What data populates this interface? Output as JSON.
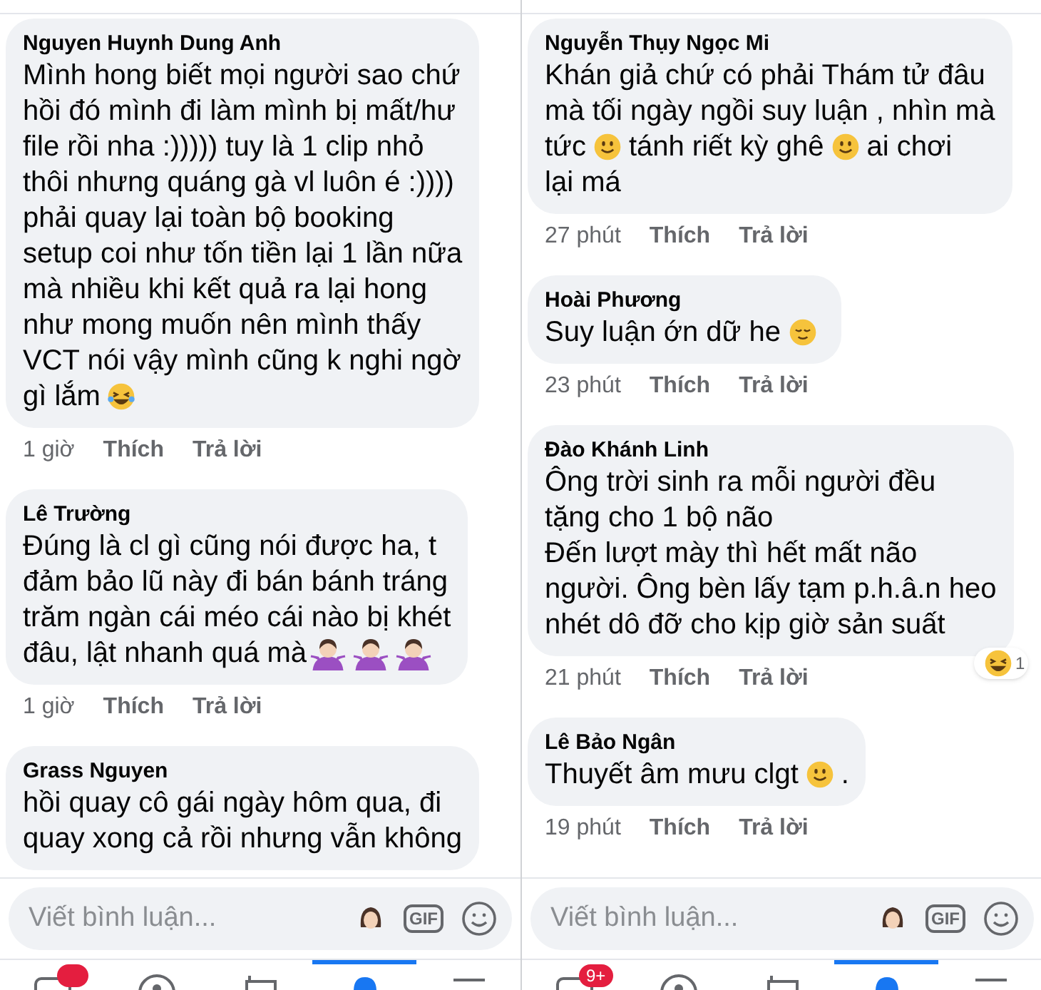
{
  "panels": [
    {
      "comments": [
        {
          "author": "Nguyen Huynh Dung Anh",
          "lines": [
            [
              {
                "kind": "text",
                "text": "Mình hong biết mọi người sao chứ"
              }
            ],
            [
              {
                "kind": "text",
                "text": "hồi đó mình đi làm mình bị mất/hư"
              }
            ],
            [
              {
                "kind": "text",
                "text": "file rồi nha :))))) tuy là 1 clip nhỏ"
              }
            ],
            [
              {
                "kind": "text",
                "text": "thôi nhưng quáng gà vl luôn é :))))"
              }
            ],
            [
              {
                "kind": "text",
                "text": "phải quay lại toàn bộ booking"
              }
            ],
            [
              {
                "kind": "text",
                "text": "setup coi như tốn tiền lại 1 lần nữa"
              }
            ],
            [
              {
                "kind": "text",
                "text": "mà nhiều khi kết quả ra lại hong"
              }
            ],
            [
              {
                "kind": "text",
                "text": "như mong muốn nên mình thấy"
              }
            ],
            [
              {
                "kind": "text",
                "text": "VCT nói vậy mình cũng k nghi ngờ"
              }
            ],
            [
              {
                "kind": "text",
                "text": "gì lắm"
              },
              {
                "kind": "tears"
              }
            ]
          ],
          "time": "1 giờ",
          "like": "Thích",
          "reply": "Trả lời"
        },
        {
          "author": "Lê Trường",
          "lines": [
            [
              {
                "kind": "text",
                "text": "Đúng là cl gì cũng nói được ha, t"
              }
            ],
            [
              {
                "kind": "text",
                "text": "đảm bảo lũ này đi bán bánh tráng"
              }
            ],
            [
              {
                "kind": "text",
                "text": "trăm ngàn cái méo cái nào bị khét"
              }
            ],
            [
              {
                "kind": "text",
                "text": "đâu, lật nhanh quá mà"
              },
              {
                "kind": "shrug"
              },
              {
                "kind": "shrug"
              },
              {
                "kind": "shrug"
              }
            ]
          ],
          "time": "1 giờ",
          "like": "Thích",
          "reply": "Trả lời"
        },
        {
          "author": "Grass Nguyen",
          "lines": [
            [
              {
                "kind": "text",
                "text": "hồi quay cô gái ngày hôm qua, đi"
              }
            ],
            [
              {
                "kind": "text",
                "text": "quay xong cả rồi nhưng vẫn không"
              }
            ]
          ]
        }
      ],
      "composer": {
        "placeholder": "Viết bình luận...",
        "gif": "GIF"
      },
      "nav": [
        {
          "selected": false,
          "has_badge": true
        },
        {
          "selected": false
        },
        {
          "selected": false
        },
        {
          "selected": true
        },
        {
          "selected": false
        }
      ]
    },
    {
      "comments": [
        {
          "author": "Nguyễn Thụy Ngọc Mi",
          "lines": [
            [
              {
                "kind": "text",
                "text": "Khán giả chứ có phải Thám tử đâu"
              }
            ],
            [
              {
                "kind": "text",
                "text": "mà tối ngày ngồi suy luận , nhìn mà"
              }
            ],
            [
              {
                "kind": "text",
                "text": "tức"
              },
              {
                "kind": "smile"
              },
              {
                "kind": "text",
                "text": "tánh riết kỳ ghê"
              },
              {
                "kind": "smile"
              },
              {
                "kind": "text",
                "text": "ai chơi"
              }
            ],
            [
              {
                "kind": "text",
                "text": "lại má"
              }
            ]
          ],
          "time": "27 phút",
          "like": "Thích",
          "reply": "Trả lời"
        },
        {
          "author": "Hoài Phương",
          "lines": [
            [
              {
                "kind": "text",
                "text": "Suy luận ớn dữ he"
              },
              {
                "kind": "relieved"
              }
            ]
          ],
          "time": "23 phút",
          "like": "Thích",
          "reply": "Trả lời"
        },
        {
          "author": "Đào Khánh Linh",
          "lines": [
            [
              {
                "kind": "text",
                "text": "Ông trời sinh ra mỗi người đều"
              }
            ],
            [
              {
                "kind": "text",
                "text": "tặng cho 1 bộ não"
              }
            ],
            [
              {
                "kind": "text",
                "text": "Đến lượt mày thì hết mất não"
              }
            ],
            [
              {
                "kind": "text",
                "text": "người. Ông bèn lấy tạm p.h.â.n heo"
              }
            ],
            [
              {
                "kind": "text",
                "text": "nhét dô đỡ cho kịp giờ sản suất"
              }
            ]
          ],
          "time": "21 phút",
          "like": "Thích",
          "reply": "Trả lời",
          "reaction_count": "1"
        },
        {
          "author": "Lê Bảo Ngân",
          "lines": [
            [
              {
                "kind": "text",
                "text": "Thuyết âm mưu clgt"
              },
              {
                "kind": "smile"
              },
              {
                "kind": "text",
                "text": "."
              }
            ]
          ],
          "time": "19 phút",
          "like": "Thích",
          "reply": "Trả lời"
        }
      ],
      "composer": {
        "placeholder": "Viết bình luận...",
        "gif": "GIF"
      },
      "nav": [
        {
          "selected": false,
          "has_badge": true,
          "badge": "9+"
        },
        {
          "selected": false
        },
        {
          "selected": false
        },
        {
          "selected": true
        },
        {
          "selected": false
        }
      ]
    }
  ]
}
